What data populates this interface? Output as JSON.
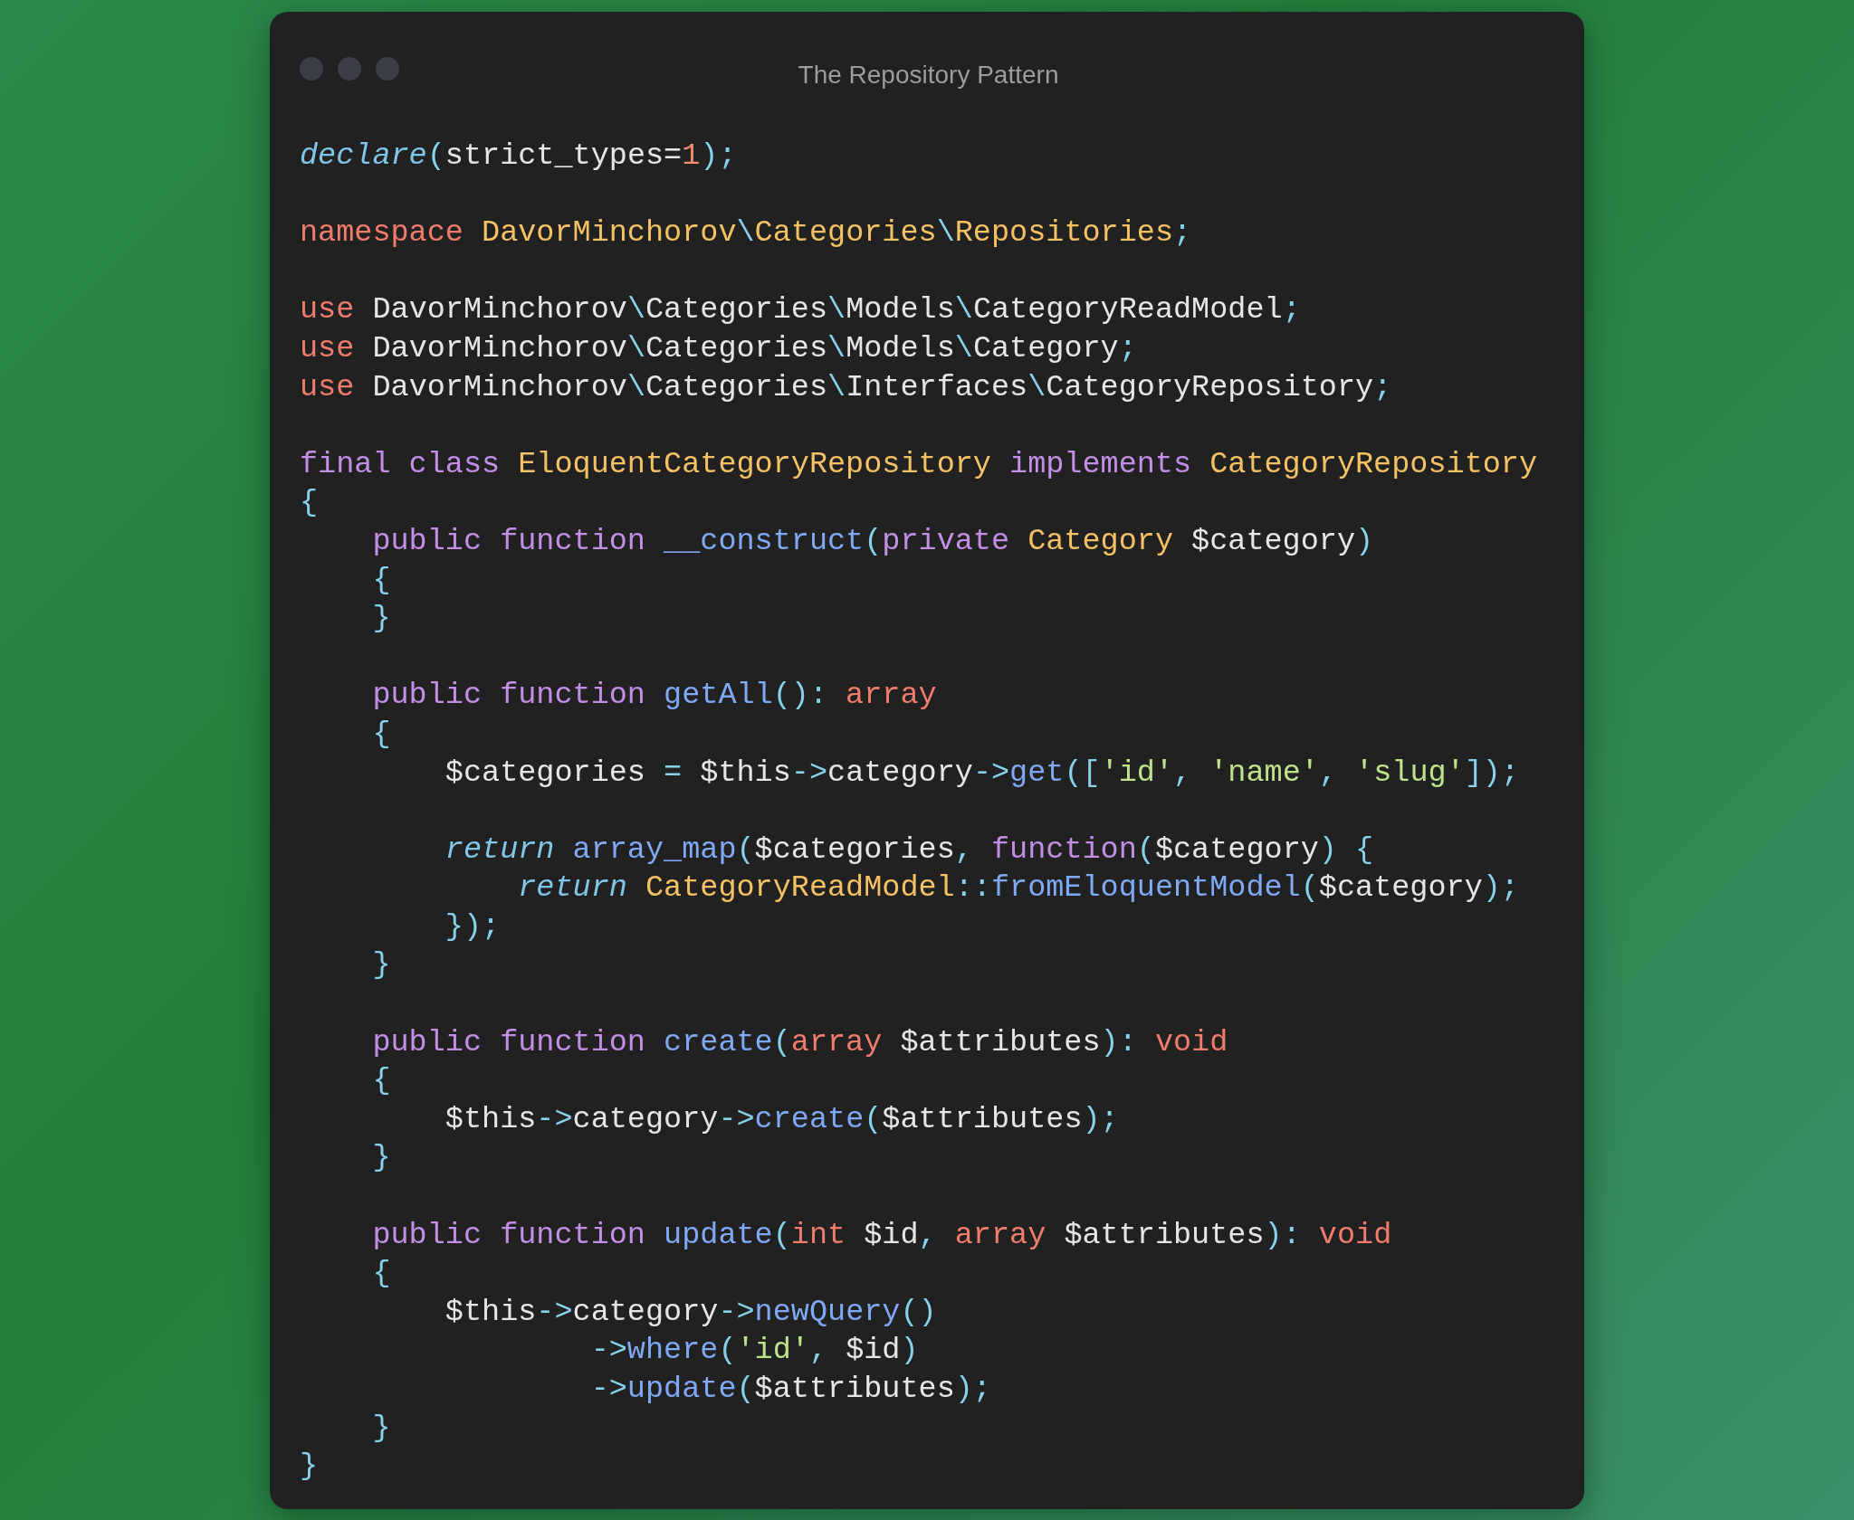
{
  "window": {
    "title": "The Repository Pattern"
  },
  "code_blocks": [
    {
      "lines": [
        {
          "tokens": [
            {
              "kind": "italic",
              "text": "declare"
            },
            {
              "kind": "punct",
              "text": "("
            },
            {
              "kind": "plain",
              "text": "strict_types="
            },
            {
              "kind": "number",
              "text": "1"
            },
            {
              "kind": "punct",
              "text": ");"
            }
          ]
        }
      ]
    },
    {
      "lines": [
        {
          "tokens": [
            {
              "kind": "keyword",
              "text": "namespace "
            },
            {
              "kind": "type",
              "text": "DavorMinchorov"
            },
            {
              "kind": "punct",
              "text": "\\"
            },
            {
              "kind": "type",
              "text": "Categories"
            },
            {
              "kind": "punct",
              "text": "\\"
            },
            {
              "kind": "type",
              "text": "Repositories"
            },
            {
              "kind": "punct",
              "text": ";"
            }
          ]
        }
      ]
    },
    {
      "lines": [
        {
          "tokens": [
            {
              "kind": "keyword",
              "text": "use "
            },
            {
              "kind": "plain",
              "text": "DavorMinchorov"
            },
            {
              "kind": "punct",
              "text": "\\"
            },
            {
              "kind": "plain",
              "text": "Categories"
            },
            {
              "kind": "punct",
              "text": "\\"
            },
            {
              "kind": "plain",
              "text": "Models"
            },
            {
              "kind": "punct",
              "text": "\\"
            },
            {
              "kind": "plain",
              "text": "CategoryReadModel"
            },
            {
              "kind": "punct",
              "text": ";"
            }
          ]
        },
        {
          "tokens": [
            {
              "kind": "keyword",
              "text": "use "
            },
            {
              "kind": "plain",
              "text": "DavorMinchorov"
            },
            {
              "kind": "punct",
              "text": "\\"
            },
            {
              "kind": "plain",
              "text": "Categories"
            },
            {
              "kind": "punct",
              "text": "\\"
            },
            {
              "kind": "plain",
              "text": "Models"
            },
            {
              "kind": "punct",
              "text": "\\"
            },
            {
              "kind": "plain",
              "text": "Category"
            },
            {
              "kind": "punct",
              "text": ";"
            }
          ]
        },
        {
          "tokens": [
            {
              "kind": "keyword",
              "text": "use "
            },
            {
              "kind": "plain",
              "text": "DavorMinchorov"
            },
            {
              "kind": "punct",
              "text": "\\"
            },
            {
              "kind": "plain",
              "text": "Categories"
            },
            {
              "kind": "punct",
              "text": "\\"
            },
            {
              "kind": "plain",
              "text": "Interfaces"
            },
            {
              "kind": "punct",
              "text": "\\"
            },
            {
              "kind": "plain",
              "text": "CategoryRepository"
            },
            {
              "kind": "punct",
              "text": ";"
            }
          ]
        }
      ]
    },
    {
      "lines": [
        {
          "tokens": [
            {
              "kind": "storage",
              "text": "final class "
            },
            {
              "kind": "type",
              "text": "EloquentCategoryRepository"
            },
            {
              "kind": "storage",
              "text": " implements "
            },
            {
              "kind": "type",
              "text": "CategoryRepository"
            }
          ]
        },
        {
          "tokens": [
            {
              "kind": "punct",
              "text": "{"
            }
          ]
        },
        {
          "tokens": [
            {
              "kind": "storage",
              "text": "    public function "
            },
            {
              "kind": "func",
              "text": "__construct"
            },
            {
              "kind": "punct",
              "text": "("
            },
            {
              "kind": "storage",
              "text": "private "
            },
            {
              "kind": "type",
              "text": "Category "
            },
            {
              "kind": "plain",
              "text": "$category"
            },
            {
              "kind": "punct",
              "text": ")"
            }
          ]
        },
        {
          "tokens": [
            {
              "kind": "punct",
              "text": "    {"
            }
          ]
        },
        {
          "tokens": [
            {
              "kind": "punct",
              "text": "    }"
            }
          ]
        }
      ]
    },
    {
      "lines": [
        {
          "tokens": [
            {
              "kind": "storage",
              "text": "    public function "
            },
            {
              "kind": "func",
              "text": "getAll"
            },
            {
              "kind": "punct",
              "text": "():"
            },
            {
              "kind": "keyword",
              "text": " array"
            }
          ]
        },
        {
          "tokens": [
            {
              "kind": "punct",
              "text": "    {"
            }
          ]
        },
        {
          "tokens": [
            {
              "kind": "plain",
              "text": "        $categories "
            },
            {
              "kind": "punct",
              "text": "= "
            },
            {
              "kind": "plain",
              "text": "$this"
            },
            {
              "kind": "punct",
              "text": "->"
            },
            {
              "kind": "plain",
              "text": "category"
            },
            {
              "kind": "punct",
              "text": "->"
            },
            {
              "kind": "func",
              "text": "get"
            },
            {
              "kind": "punct",
              "text": "(["
            },
            {
              "kind": "string",
              "text": "'id'"
            },
            {
              "kind": "punct",
              "text": ", "
            },
            {
              "kind": "string",
              "text": "'name'"
            },
            {
              "kind": "punct",
              "text": ", "
            },
            {
              "kind": "string",
              "text": "'slug'"
            },
            {
              "kind": "punct",
              "text": "]);"
            }
          ]
        }
      ]
    },
    {
      "lines": [
        {
          "tokens": [
            {
              "kind": "italic",
              "text": "        return "
            },
            {
              "kind": "func",
              "text": "array_map"
            },
            {
              "kind": "punct",
              "text": "("
            },
            {
              "kind": "plain",
              "text": "$categories"
            },
            {
              "kind": "punct",
              "text": ", "
            },
            {
              "kind": "storage",
              "text": "function"
            },
            {
              "kind": "punct",
              "text": "("
            },
            {
              "kind": "plain",
              "text": "$category"
            },
            {
              "kind": "punct",
              "text": ") {"
            }
          ]
        },
        {
          "tokens": [
            {
              "kind": "italic",
              "text": "            return "
            },
            {
              "kind": "type",
              "text": "CategoryReadModel"
            },
            {
              "kind": "punct",
              "text": "::"
            },
            {
              "kind": "func",
              "text": "fromEloquentModel"
            },
            {
              "kind": "punct",
              "text": "("
            },
            {
              "kind": "plain",
              "text": "$category"
            },
            {
              "kind": "punct",
              "text": ");"
            }
          ]
        },
        {
          "tokens": [
            {
              "kind": "punct",
              "text": "        });"
            }
          ]
        },
        {
          "tokens": [
            {
              "kind": "punct",
              "text": "    }"
            }
          ]
        }
      ]
    },
    {
      "lines": [
        {
          "tokens": [
            {
              "kind": "storage",
              "text": "    public function "
            },
            {
              "kind": "func",
              "text": "create"
            },
            {
              "kind": "punct",
              "text": "("
            },
            {
              "kind": "keyword",
              "text": "array "
            },
            {
              "kind": "plain",
              "text": "$attributes"
            },
            {
              "kind": "punct",
              "text": "): "
            },
            {
              "kind": "keyword",
              "text": "void"
            }
          ]
        },
        {
          "tokens": [
            {
              "kind": "punct",
              "text": "    {"
            }
          ]
        },
        {
          "tokens": [
            {
              "kind": "plain",
              "text": "        $this"
            },
            {
              "kind": "punct",
              "text": "->"
            },
            {
              "kind": "plain",
              "text": "category"
            },
            {
              "kind": "punct",
              "text": "->"
            },
            {
              "kind": "func",
              "text": "create"
            },
            {
              "kind": "punct",
              "text": "("
            },
            {
              "kind": "plain",
              "text": "$attributes"
            },
            {
              "kind": "punct",
              "text": ");"
            }
          ]
        },
        {
          "tokens": [
            {
              "kind": "punct",
              "text": "    }"
            }
          ]
        }
      ]
    },
    {
      "lines": [
        {
          "tokens": [
            {
              "kind": "storage",
              "text": "    public function "
            },
            {
              "kind": "func",
              "text": "update"
            },
            {
              "kind": "punct",
              "text": "("
            },
            {
              "kind": "keyword",
              "text": "int "
            },
            {
              "kind": "plain",
              "text": "$id"
            },
            {
              "kind": "punct",
              "text": ", "
            },
            {
              "kind": "keyword",
              "text": "array "
            },
            {
              "kind": "plain",
              "text": "$attributes"
            },
            {
              "kind": "punct",
              "text": "): "
            },
            {
              "kind": "keyword",
              "text": "void"
            }
          ]
        },
        {
          "tokens": [
            {
              "kind": "punct",
              "text": "    {"
            }
          ]
        },
        {
          "tokens": [
            {
              "kind": "plain",
              "text": "        $this"
            },
            {
              "kind": "punct",
              "text": "->"
            },
            {
              "kind": "plain",
              "text": "category"
            },
            {
              "kind": "punct",
              "text": "->"
            },
            {
              "kind": "func",
              "text": "newQuery"
            },
            {
              "kind": "punct",
              "text": "()"
            }
          ]
        },
        {
          "tokens": [
            {
              "kind": "punct",
              "text": "                ->"
            },
            {
              "kind": "func",
              "text": "where"
            },
            {
              "kind": "punct",
              "text": "("
            },
            {
              "kind": "string",
              "text": "'id'"
            },
            {
              "kind": "punct",
              "text": ", "
            },
            {
              "kind": "plain",
              "text": "$id"
            },
            {
              "kind": "punct",
              "text": ")"
            }
          ]
        },
        {
          "tokens": [
            {
              "kind": "punct",
              "text": "                ->"
            },
            {
              "kind": "func",
              "text": "update"
            },
            {
              "kind": "punct",
              "text": "("
            },
            {
              "kind": "plain",
              "text": "$attributes"
            },
            {
              "kind": "punct",
              "text": ");"
            }
          ]
        },
        {
          "tokens": [
            {
              "kind": "punct",
              "text": "    }"
            }
          ]
        },
        {
          "tokens": [
            {
              "kind": "punct",
              "text": "}"
            }
          ]
        }
      ]
    }
  ]
}
